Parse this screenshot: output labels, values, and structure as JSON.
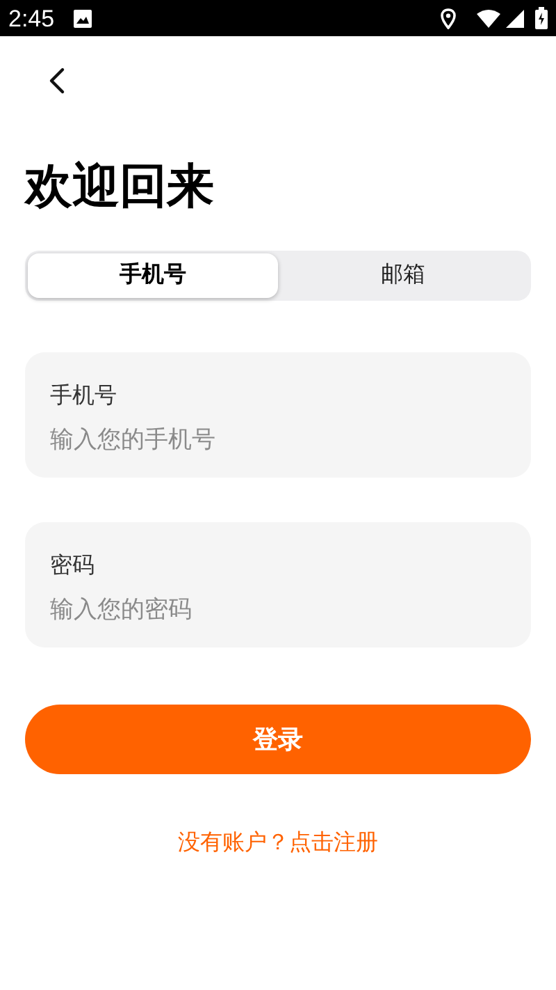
{
  "status_bar": {
    "time": "2:45"
  },
  "title": "欢迎回来",
  "tabs": [
    {
      "label": "手机号",
      "selected": true
    },
    {
      "label": "邮箱",
      "selected": false
    }
  ],
  "fields": [
    {
      "label": "手机号",
      "placeholder": "输入您的手机号"
    },
    {
      "label": "密码",
      "placeholder": "输入您的密码"
    }
  ],
  "login_button": "登录",
  "register_link": "没有账户？点击注册"
}
